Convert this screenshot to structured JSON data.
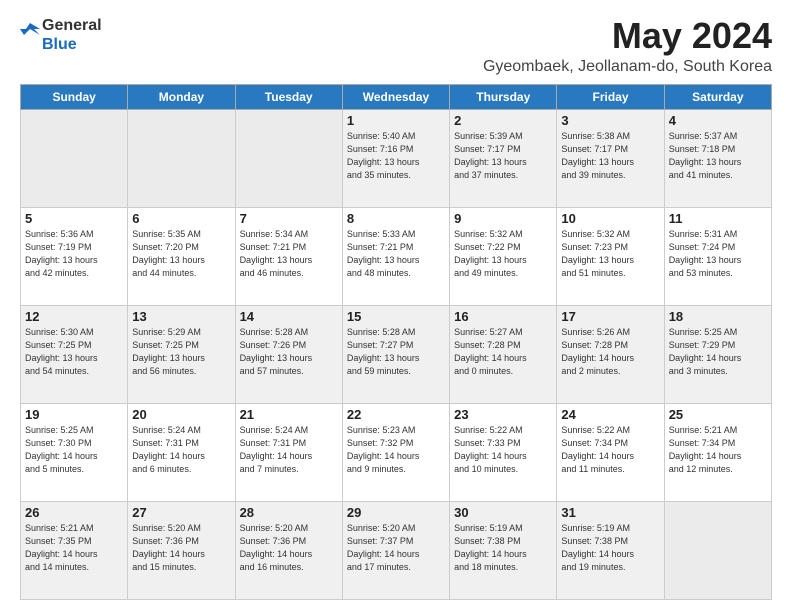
{
  "logo": {
    "line1": "General",
    "line2": "Blue"
  },
  "title": "May 2024",
  "subtitle": "Gyeombaek, Jeollanam-do, South Korea",
  "headers": [
    "Sunday",
    "Monday",
    "Tuesday",
    "Wednesday",
    "Thursday",
    "Friday",
    "Saturday"
  ],
  "weeks": [
    [
      {
        "day": "",
        "info": ""
      },
      {
        "day": "",
        "info": ""
      },
      {
        "day": "",
        "info": ""
      },
      {
        "day": "1",
        "info": "Sunrise: 5:40 AM\nSunset: 7:16 PM\nDaylight: 13 hours\nand 35 minutes."
      },
      {
        "day": "2",
        "info": "Sunrise: 5:39 AM\nSunset: 7:17 PM\nDaylight: 13 hours\nand 37 minutes."
      },
      {
        "day": "3",
        "info": "Sunrise: 5:38 AM\nSunset: 7:17 PM\nDaylight: 13 hours\nand 39 minutes."
      },
      {
        "day": "4",
        "info": "Sunrise: 5:37 AM\nSunset: 7:18 PM\nDaylight: 13 hours\nand 41 minutes."
      }
    ],
    [
      {
        "day": "5",
        "info": "Sunrise: 5:36 AM\nSunset: 7:19 PM\nDaylight: 13 hours\nand 42 minutes."
      },
      {
        "day": "6",
        "info": "Sunrise: 5:35 AM\nSunset: 7:20 PM\nDaylight: 13 hours\nand 44 minutes."
      },
      {
        "day": "7",
        "info": "Sunrise: 5:34 AM\nSunset: 7:21 PM\nDaylight: 13 hours\nand 46 minutes."
      },
      {
        "day": "8",
        "info": "Sunrise: 5:33 AM\nSunset: 7:21 PM\nDaylight: 13 hours\nand 48 minutes."
      },
      {
        "day": "9",
        "info": "Sunrise: 5:32 AM\nSunset: 7:22 PM\nDaylight: 13 hours\nand 49 minutes."
      },
      {
        "day": "10",
        "info": "Sunrise: 5:32 AM\nSunset: 7:23 PM\nDaylight: 13 hours\nand 51 minutes."
      },
      {
        "day": "11",
        "info": "Sunrise: 5:31 AM\nSunset: 7:24 PM\nDaylight: 13 hours\nand 53 minutes."
      }
    ],
    [
      {
        "day": "12",
        "info": "Sunrise: 5:30 AM\nSunset: 7:25 PM\nDaylight: 13 hours\nand 54 minutes."
      },
      {
        "day": "13",
        "info": "Sunrise: 5:29 AM\nSunset: 7:25 PM\nDaylight: 13 hours\nand 56 minutes."
      },
      {
        "day": "14",
        "info": "Sunrise: 5:28 AM\nSunset: 7:26 PM\nDaylight: 13 hours\nand 57 minutes."
      },
      {
        "day": "15",
        "info": "Sunrise: 5:28 AM\nSunset: 7:27 PM\nDaylight: 13 hours\nand 59 minutes."
      },
      {
        "day": "16",
        "info": "Sunrise: 5:27 AM\nSunset: 7:28 PM\nDaylight: 14 hours\nand 0 minutes."
      },
      {
        "day": "17",
        "info": "Sunrise: 5:26 AM\nSunset: 7:28 PM\nDaylight: 14 hours\nand 2 minutes."
      },
      {
        "day": "18",
        "info": "Sunrise: 5:25 AM\nSunset: 7:29 PM\nDaylight: 14 hours\nand 3 minutes."
      }
    ],
    [
      {
        "day": "19",
        "info": "Sunrise: 5:25 AM\nSunset: 7:30 PM\nDaylight: 14 hours\nand 5 minutes."
      },
      {
        "day": "20",
        "info": "Sunrise: 5:24 AM\nSunset: 7:31 PM\nDaylight: 14 hours\nand 6 minutes."
      },
      {
        "day": "21",
        "info": "Sunrise: 5:24 AM\nSunset: 7:31 PM\nDaylight: 14 hours\nand 7 minutes."
      },
      {
        "day": "22",
        "info": "Sunrise: 5:23 AM\nSunset: 7:32 PM\nDaylight: 14 hours\nand 9 minutes."
      },
      {
        "day": "23",
        "info": "Sunrise: 5:22 AM\nSunset: 7:33 PM\nDaylight: 14 hours\nand 10 minutes."
      },
      {
        "day": "24",
        "info": "Sunrise: 5:22 AM\nSunset: 7:34 PM\nDaylight: 14 hours\nand 11 minutes."
      },
      {
        "day": "25",
        "info": "Sunrise: 5:21 AM\nSunset: 7:34 PM\nDaylight: 14 hours\nand 12 minutes."
      }
    ],
    [
      {
        "day": "26",
        "info": "Sunrise: 5:21 AM\nSunset: 7:35 PM\nDaylight: 14 hours\nand 14 minutes."
      },
      {
        "day": "27",
        "info": "Sunrise: 5:20 AM\nSunset: 7:36 PM\nDaylight: 14 hours\nand 15 minutes."
      },
      {
        "day": "28",
        "info": "Sunrise: 5:20 AM\nSunset: 7:36 PM\nDaylight: 14 hours\nand 16 minutes."
      },
      {
        "day": "29",
        "info": "Sunrise: 5:20 AM\nSunset: 7:37 PM\nDaylight: 14 hours\nand 17 minutes."
      },
      {
        "day": "30",
        "info": "Sunrise: 5:19 AM\nSunset: 7:38 PM\nDaylight: 14 hours\nand 18 minutes."
      },
      {
        "day": "31",
        "info": "Sunrise: 5:19 AM\nSunset: 7:38 PM\nDaylight: 14 hours\nand 19 minutes."
      },
      {
        "day": "",
        "info": ""
      }
    ]
  ]
}
